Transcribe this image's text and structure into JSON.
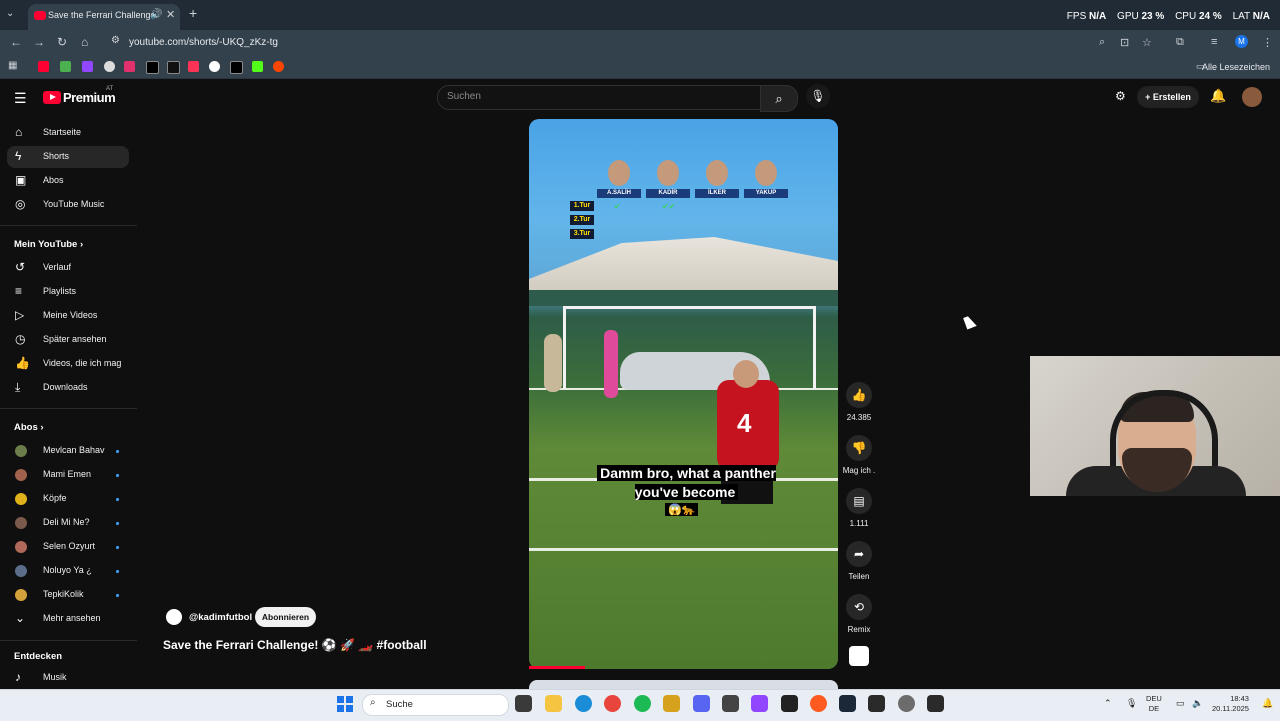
{
  "browser": {
    "tab_title": "Save the Ferrari Challenge!",
    "url": "youtube.com/shorts/-UKQ_zKz-tg",
    "all_bookmarks": "Alle Lesezeichen"
  },
  "overlay_stats": {
    "fps_label": "FPS",
    "fps_value": "N/A",
    "gpu_label": "GPU",
    "gpu_value": "23 %",
    "cpu_label": "CPU",
    "cpu_value": "24 %",
    "lat_label": "LAT",
    "lat_value": "N/A"
  },
  "header": {
    "brand": "Premium",
    "region": "AT",
    "search_placeholder": "Suchen",
    "create_label": "Erstellen"
  },
  "sidebar": {
    "main": [
      {
        "label": "Startseite",
        "icon": "home-icon"
      },
      {
        "label": "Shorts",
        "icon": "shorts-icon"
      },
      {
        "label": "Abos",
        "icon": "subscriptions-icon"
      },
      {
        "label": "YouTube Music",
        "icon": "music-icon"
      }
    ],
    "you_heading": "Mein YouTube",
    "you": [
      {
        "label": "Verlauf",
        "icon": "history-icon"
      },
      {
        "label": "Playlists",
        "icon": "playlists-icon"
      },
      {
        "label": "Meine Videos",
        "icon": "my-videos-icon"
      },
      {
        "label": "Später ansehen",
        "icon": "watch-later-icon"
      },
      {
        "label": "Videos, die ich mag",
        "icon": "liked-icon"
      },
      {
        "label": "Downloads",
        "icon": "download-icon"
      }
    ],
    "subs_heading": "Abos",
    "subs": [
      {
        "label": "Mevlcan Bahav",
        "color": "#6b7d4a"
      },
      {
        "label": "Mami Emen",
        "color": "#a0624d"
      },
      {
        "label": "Köpfe",
        "color": "#e0b21a"
      },
      {
        "label": "Deli Mi Ne?",
        "color": "#7a5a4a"
      },
      {
        "label": "Selen Ozyurt",
        "color": "#b0685a"
      },
      {
        "label": "Noluyo Ya ¿",
        "color": "#5a6e8a"
      },
      {
        "label": "TepkiKolik",
        "color": "#d4a23a"
      }
    ],
    "more_label": "Mehr ansehen",
    "explore_heading": "Entdecken",
    "explore": [
      {
        "label": "Musik",
        "icon": "music-note-icon"
      }
    ]
  },
  "video": {
    "players": [
      "A.SALİH",
      "KADİR",
      "İLKER",
      "YAKUP"
    ],
    "rounds": [
      "1.Tur",
      "2.Tur",
      "3.Tur"
    ],
    "caption": "Damm bro, what a panther you've become",
    "caption_emoji": "😱🐆",
    "progress": 0.18,
    "jersey_number": "4"
  },
  "actions": {
    "likes": "24.385",
    "dislike_label": "Mag ich .",
    "comments": "1.111",
    "share_label": "Teilen",
    "remix_label": "Remix"
  },
  "channel": {
    "handle": "@kadimfutbol",
    "subscribe_label": "Abonnieren",
    "title": "Save the Ferrari Challenge! ⚽ 🚀 🏎️ #football"
  },
  "taskbar": {
    "search_label": "Suche",
    "lang_top": "DEU",
    "lang_bottom": "DE",
    "time": "18:43",
    "date": "20.11.2025"
  }
}
